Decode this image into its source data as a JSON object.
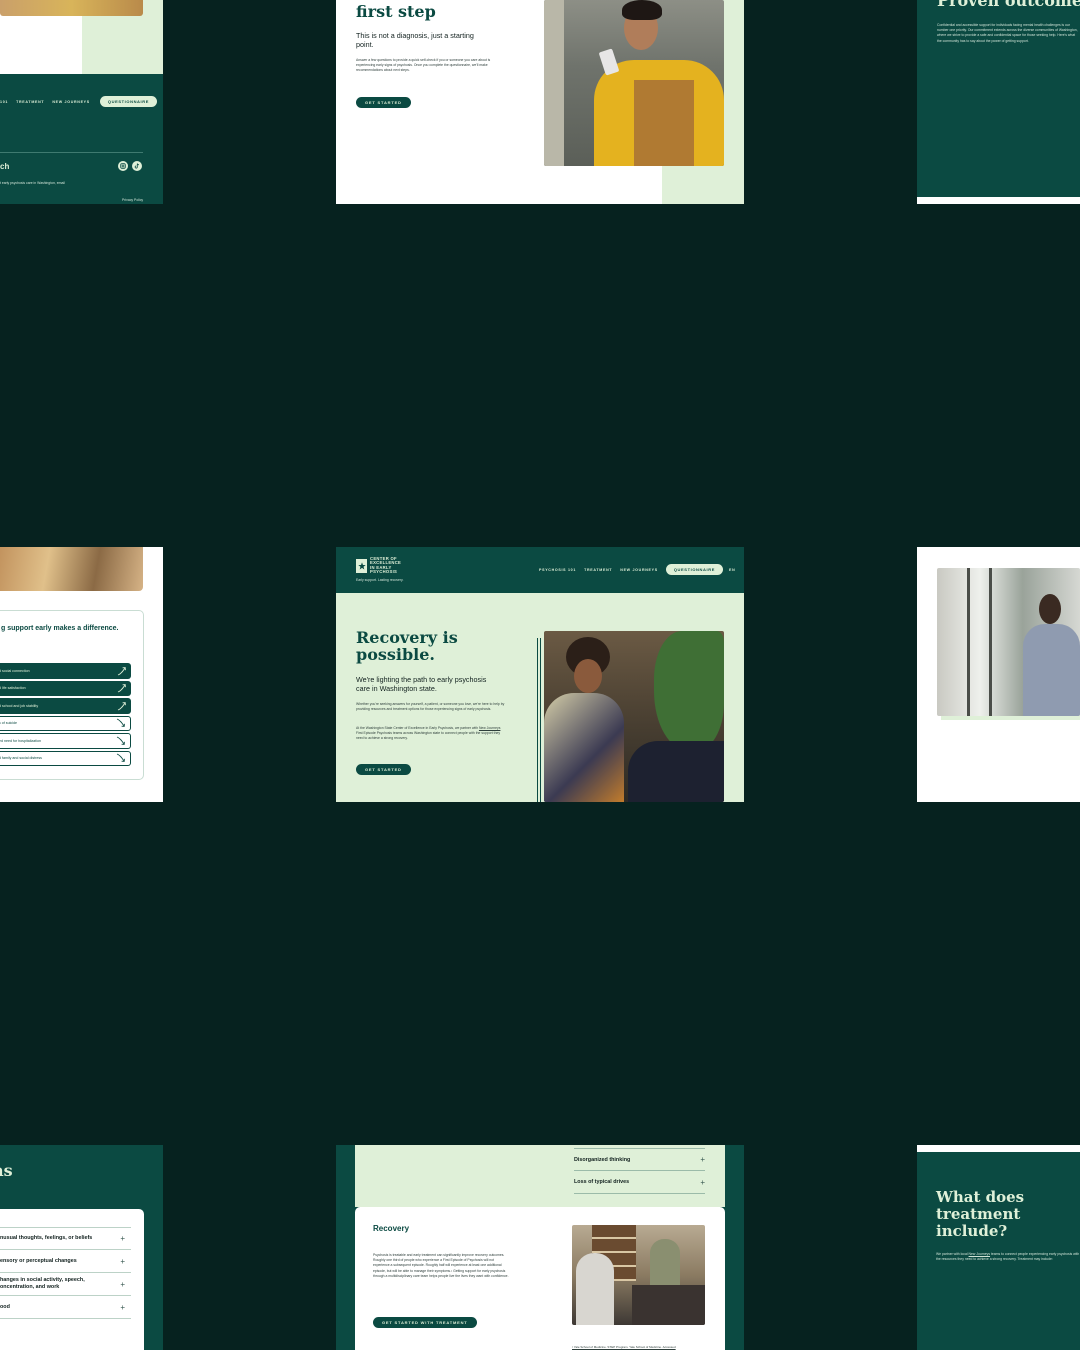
{
  "colors": {
    "background": "#06221f",
    "brand_green": "#0b4a42",
    "mint": "#dff0d8"
  },
  "top_left": {
    "nav_items": [
      "101",
      "TREATMENT",
      "NEW JOURNEYS"
    ],
    "nav_cta": "QUESTIONNAIRE",
    "footer_heading": "ch",
    "footer_text": "t early psychosis care in Washington, email",
    "footer_link": "Privacy Policy",
    "social_icons": [
      "instagram-icon",
      "tiktok-icon"
    ]
  },
  "top_center": {
    "heading": "first step",
    "subheading": "This is not a diagnosis, just a starting point.",
    "body": "Answer a few questions to provide a quick self-check if you or someone you care about is experiencing early signs of psychosis. Once you complete the questionnaire, we'll make recommendations about next steps.",
    "cta": "GET STARTED"
  },
  "top_right": {
    "heading": "Proven outcomes",
    "body": "Confidential and accessible support for individuals facing mental health challenges is our number one priority. Our commitment extends across the diverse communities of Washington, where we strive to provide a safe and confidential space for those seeking help. Here's what the community has to say about the power of getting support."
  },
  "middle_left": {
    "heading": "g support early makes a difference.",
    "outcomes": [
      {
        "label": "d social connection",
        "direction": "up"
      },
      {
        "label": "d life satisfaction",
        "direction": "up"
      },
      {
        "label": "d school and job stability",
        "direction": "up"
      },
      {
        "label": "k of suicide",
        "direction": "down"
      },
      {
        "label": "ed need for hospitalization",
        "direction": "down"
      },
      {
        "label": "d family and social distress",
        "direction": "down"
      }
    ]
  },
  "hero": {
    "logo_lines": [
      "CENTER OF",
      "EXCELLENCE",
      "IN EARLY",
      "PSYCHOSIS"
    ],
    "tagline": "Early support. Lasting recovery.",
    "nav": [
      "PSYCHOSIS 101",
      "TREATMENT",
      "NEW JOURNEYS"
    ],
    "nav_cta": "QUESTIONNAIRE",
    "lang": "EN",
    "title": "Recovery is possible.",
    "subtitle": "We're lighting the path to early psychosis care in Washington state.",
    "body1": "Whether you're seeking answers for yourself, a patient, or someone you love, we're here to help by providing resources and treatment options for those experiencing signs of early psychosis.",
    "body2_pre": "At the Washington State Center of Excellence in Early Psychosis, we partner with ",
    "body2_link": "New Journeys",
    "body2_post": " First Episode Psychosis teams across Washington state to connect people with the support they need to achieve a strong recovery.",
    "cta": "GET STARTED"
  },
  "bottom_left": {
    "heading": "ns",
    "accordion": [
      "nusual thoughts, feelings, or beliefs",
      "ensory or perceptual changes",
      "hanges in social activity, speech, oncentration, and work",
      "ood"
    ]
  },
  "bottom_center": {
    "accordion": [
      "Disorganized thinking",
      "Loss of typical drives"
    ],
    "card_title": "Recovery",
    "card_body": "Psychosis is treatable and early treatment can significantly improve recovery outcomes. Roughly one third of people who experience a First Episode of Psychosis will not experience a subsequent episode. Roughly half will experience at least one additional episode, but will be able to manage their symptoms.¹ Getting support for early psychosis through a multidisciplinary care team helps people live the lives they want with confidence.",
    "cta": "GET STARTED WITH TREATMENT",
    "footnote": "¹ Yale School of Medicine. STEP Program. Yale School of Medicine. Accessed"
  },
  "bottom_right": {
    "heading": "What does treatment include?",
    "body_pre": "We partner with local ",
    "body_link": "New Journeys",
    "body_post": " teams to connect people experiencing early psychosis with the resources they need to achieve a strong recovery. Treatment may include:"
  }
}
